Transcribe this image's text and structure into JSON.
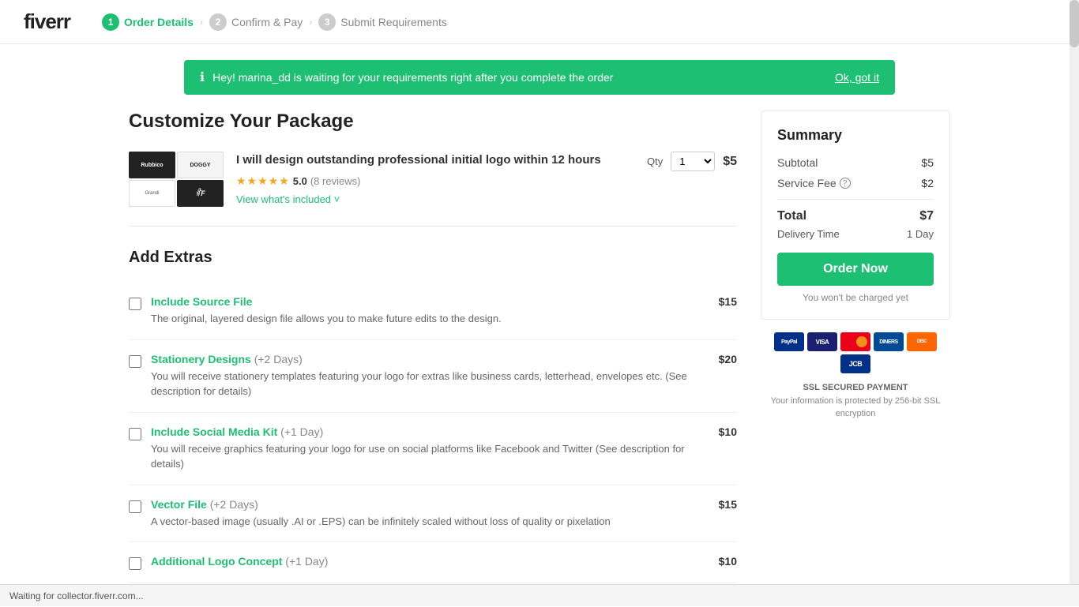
{
  "logo": {
    "text1": "fiver",
    "text2": "r"
  },
  "breadcrumb": {
    "steps": [
      {
        "number": "1",
        "label": "Order Details",
        "state": "active"
      },
      {
        "number": "2",
        "label": "Confirm & Pay",
        "state": "inactive"
      },
      {
        "number": "3",
        "label": "Submit Requirements",
        "state": "inactive"
      }
    ]
  },
  "alert": {
    "message": "Hey! marina_dd is waiting for your requirements right after you complete the order",
    "action_label": "Ok, got it"
  },
  "page": {
    "title": "Customize Your Package"
  },
  "product": {
    "title": "I will design outstanding professional initial logo within 12 hours",
    "rating_stars": "★★★★★",
    "rating_score": "5.0",
    "rating_count": "(8 reviews)",
    "view_included": "View what's included ˅",
    "qty_label": "Qty",
    "qty_value": "1",
    "price": "$5"
  },
  "extras": {
    "title": "Add Extras",
    "items": [
      {
        "name": "Include Source File",
        "days": "",
        "description": "The original, layered design file allows you to make future edits to the design.",
        "price": "$15"
      },
      {
        "name": "Stationery Designs",
        "days": "(+2 Days)",
        "description": "You will receive stationery templates featuring your logo for extras like business cards, letterhead, envelopes etc. (See description for details)",
        "price": "$20"
      },
      {
        "name": "Include Social Media Kit",
        "days": "(+1 Day)",
        "description": "You will receive graphics featuring your logo for use on social platforms like Facebook and Twitter (See description for details)",
        "price": "$10"
      },
      {
        "name": "Vector File",
        "days": "(+2 Days)",
        "description": "A vector-based image (usually .AI or .EPS) can be infinitely scaled without loss of quality or pixelation",
        "price": "$15"
      },
      {
        "name": "Additional Logo Concept",
        "days": "(+1 Day)",
        "description": "",
        "price": "$10"
      }
    ]
  },
  "summary": {
    "title": "Summary",
    "subtotal_label": "Subtotal",
    "subtotal_value": "$5",
    "service_fee_label": "Service Fee",
    "service_fee_value": "$2",
    "total_label": "Total",
    "total_value": "$7",
    "delivery_label": "Delivery Time",
    "delivery_value": "1 Day",
    "order_btn": "Order Now",
    "not_charged": "You won't be charged yet",
    "ssl_title": "SSL SECURED PAYMENT",
    "ssl_desc": "Your information is protected by 256-bit SSL encryption"
  },
  "payment_icons": [
    {
      "name": "PayPal",
      "class": "pay-paypal"
    },
    {
      "name": "VISA",
      "class": "pay-visa"
    },
    {
      "name": "MC",
      "class": "pay-mc"
    },
    {
      "name": "DINERS",
      "class": "pay-diners"
    },
    {
      "name": "DISC",
      "class": "pay-discover"
    },
    {
      "name": "JCB",
      "class": "pay-jcb"
    }
  ],
  "status_bar": {
    "text": "Waiting for collector.fiverr.com..."
  }
}
